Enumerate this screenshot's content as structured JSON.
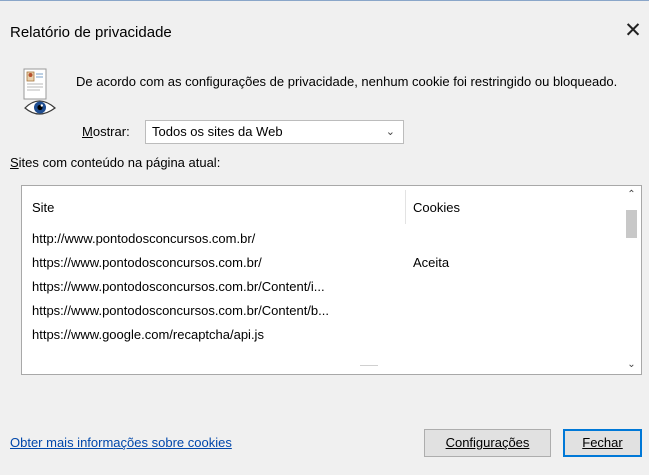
{
  "dialog": {
    "title": "Relatório de privacidade",
    "close_glyph": "✕",
    "message": "De acordo com as configurações de privacidade, nenhum cookie foi restringido ou bloqueado.",
    "show_label": "Mostrar:",
    "show_label_accelerator": "M",
    "show_label_rest": "ostrar:",
    "show_select": {
      "value": "Todos os sites da Web",
      "options": [
        "Todos os sites da Web"
      ]
    },
    "sites_label": "Sites com conteúdo na página atual:",
    "sites_label_accelerator": "S",
    "sites_label_rest": "ites com conteúdo na página atual:"
  },
  "sites_table": {
    "columns": [
      "Site",
      "Cookies"
    ],
    "rows": [
      {
        "site": "http://www.pontodosconcursos.com.br/",
        "cookies": ""
      },
      {
        "site": "https://www.pontodosconcursos.com.br/",
        "cookies": "Aceita"
      },
      {
        "site": "https://www.pontodosconcursos.com.br/Content/i...",
        "cookies": ""
      },
      {
        "site": "https://www.pontodosconcursos.com.br/Content/b...",
        "cookies": ""
      },
      {
        "site": "https://www.google.com/recaptcha/api.js",
        "cookies": ""
      }
    ]
  },
  "footer": {
    "more_info_link": "Obter mais informações sobre cookies",
    "settings_button": "Configurações",
    "close_button": "Fechar"
  },
  "icons": {
    "privacy": "privacy-report-icon",
    "close": "close-icon",
    "dropdown": "chevron-down-icon"
  },
  "colors": {
    "link": "#0047ab",
    "focus_border": "#0078d7",
    "dialog_background": "#f0f0f0"
  }
}
